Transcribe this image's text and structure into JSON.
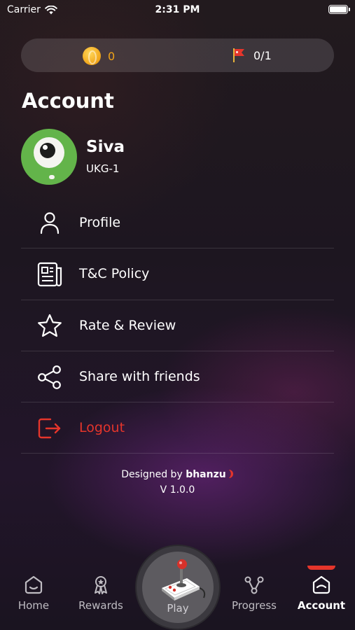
{
  "status_bar": {
    "carrier": "Carrier",
    "time": "2:31 PM"
  },
  "stats": {
    "coins": "0",
    "flags": "0/1"
  },
  "page": {
    "title": "Account"
  },
  "user": {
    "name": "Siva",
    "grade": "UKG-1"
  },
  "menu": [
    {
      "label": "Profile",
      "icon": "person-icon"
    },
    {
      "label": "T&C Policy",
      "icon": "document-icon"
    },
    {
      "label": "Rate & Review",
      "icon": "star-icon"
    },
    {
      "label": "Share with friends",
      "icon": "share-icon"
    },
    {
      "label": "Logout",
      "icon": "logout-icon",
      "color": "#e5352b"
    }
  ],
  "footer": {
    "designed_by": "Designed by",
    "brand": "bhanzu",
    "version": "V 1.0.0"
  },
  "tabbar": {
    "home": "Home",
    "rewards": "Rewards",
    "play": "Play",
    "progress": "Progress",
    "account": "Account",
    "active": "Account"
  },
  "colors": {
    "accent_red": "#e5352b",
    "coin_gold": "#f0a418",
    "avatar_green": "#63b44a"
  }
}
